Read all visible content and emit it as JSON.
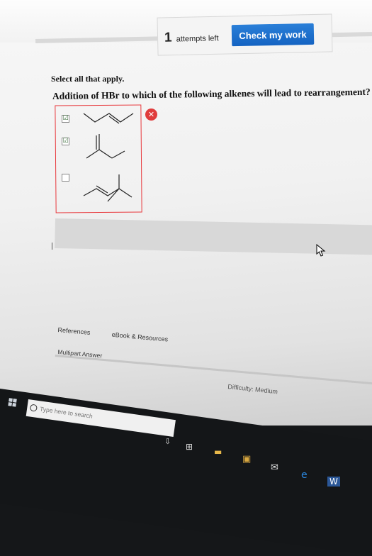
{
  "header": {
    "attempts_count": "1",
    "attempts_label": "attempts left",
    "check_button": "Check my work"
  },
  "question": {
    "instruction": "Select all that apply.",
    "prompt": "Addition of HBr to which of the following alkenes will lead to rearrangement?",
    "options": [
      {
        "checked": true,
        "mark": "☑"
      },
      {
        "checked": true,
        "mark": "☑"
      },
      {
        "checked": false,
        "mark": ""
      }
    ],
    "result_icon": "✕"
  },
  "footer": {
    "references": "References",
    "ebook": "eBook & Resources",
    "multipart": "Multipart Answer",
    "difficulty": "Difficulty: Medium"
  },
  "taskbar": {
    "search_placeholder": "Type here to search"
  },
  "colors": {
    "accent": "#1a6fd0",
    "error": "#e03c3c"
  }
}
